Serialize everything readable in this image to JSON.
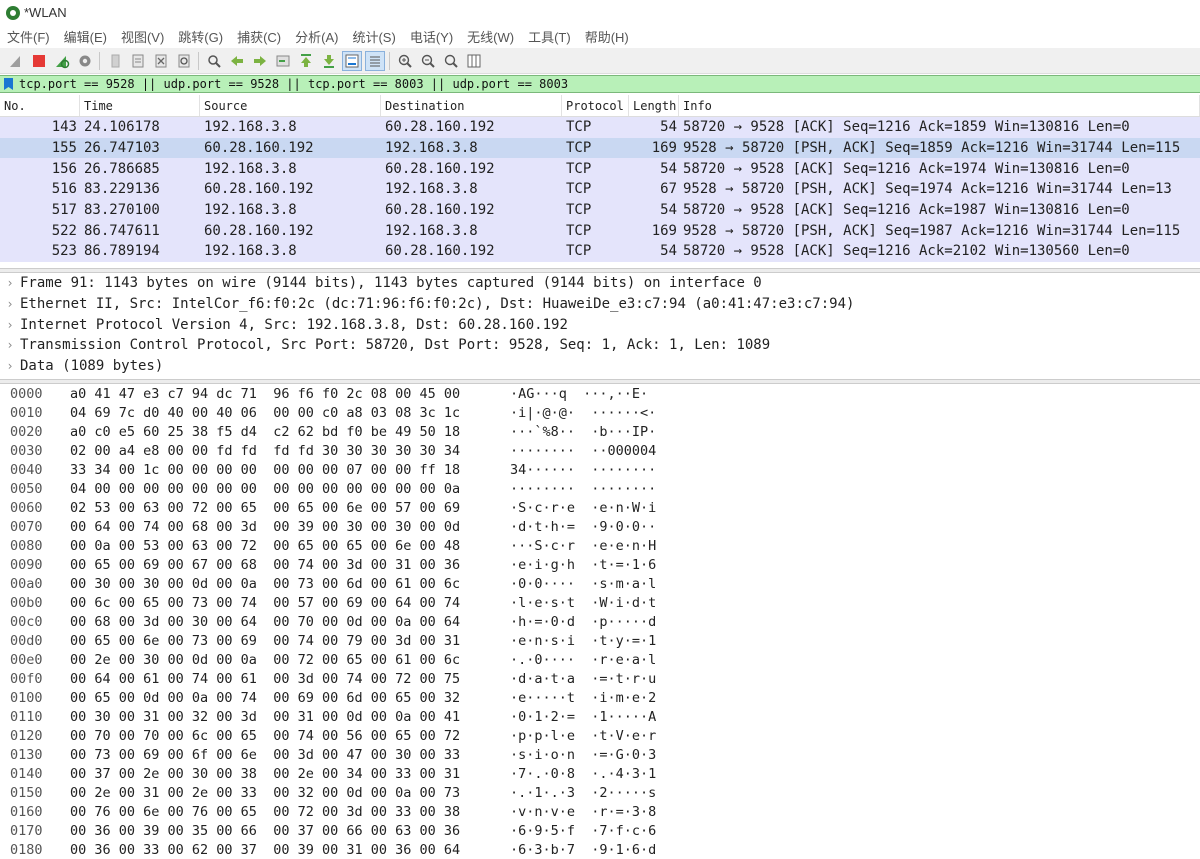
{
  "window": {
    "title": "*WLAN"
  },
  "menu": [
    "文件(F)",
    "编辑(E)",
    "视图(V)",
    "跳转(G)",
    "捕获(C)",
    "分析(A)",
    "统计(S)",
    "电话(Y)",
    "无线(W)",
    "工具(T)",
    "帮助(H)"
  ],
  "toolbar_icons": [
    "shark-fin-icon",
    "stop-icon",
    "restart-icon",
    "options-gear-icon",
    "open-file-icon",
    "save-file-icon",
    "close-file-icon",
    "reload-icon",
    "find-icon",
    "go-back-icon",
    "go-forward-icon",
    "go-to-packet-icon",
    "go-first-icon",
    "go-last-icon",
    "autoscroll-icon",
    "colorize-icon",
    "zoom-in-icon",
    "zoom-out-icon",
    "zoom-normal-icon",
    "resize-columns-icon"
  ],
  "filter": {
    "value": "tcp.port == 9528 || udp.port == 9528 || tcp.port == 8003 || udp.port == 8003"
  },
  "columns": [
    "No.",
    "Time",
    "Source",
    "Destination",
    "Protocol",
    "Length",
    "Info"
  ],
  "packets": [
    {
      "no": "143",
      "time": "24.106178",
      "src": "192.168.3.8",
      "dst": "60.28.160.192",
      "proto": "TCP",
      "len": "54",
      "info": "58720 → 9528 [ACK] Seq=1216 Ack=1859 Win=130816 Len=0"
    },
    {
      "no": "155",
      "time": "26.747103",
      "src": "60.28.160.192",
      "dst": "192.168.3.8",
      "proto": "TCP",
      "len": "169",
      "info": "9528 → 58720 [PSH, ACK] Seq=1859 Ack=1216 Win=31744 Len=115"
    },
    {
      "no": "156",
      "time": "26.786685",
      "src": "192.168.3.8",
      "dst": "60.28.160.192",
      "proto": "TCP",
      "len": "54",
      "info": "58720 → 9528 [ACK] Seq=1216 Ack=1974 Win=130816 Len=0"
    },
    {
      "no": "516",
      "time": "83.229136",
      "src": "60.28.160.192",
      "dst": "192.168.3.8",
      "proto": "TCP",
      "len": "67",
      "info": "9528 → 58720 [PSH, ACK] Seq=1974 Ack=1216 Win=31744 Len=13"
    },
    {
      "no": "517",
      "time": "83.270100",
      "src": "192.168.3.8",
      "dst": "60.28.160.192",
      "proto": "TCP",
      "len": "54",
      "info": "58720 → 9528 [ACK] Seq=1216 Ack=1987 Win=130816 Len=0"
    },
    {
      "no": "522",
      "time": "86.747611",
      "src": "60.28.160.192",
      "dst": "192.168.3.8",
      "proto": "TCP",
      "len": "169",
      "info": "9528 → 58720 [PSH, ACK] Seq=1987 Ack=1216 Win=31744 Len=115"
    },
    {
      "no": "523",
      "time": "86.789194",
      "src": "192.168.3.8",
      "dst": "60.28.160.192",
      "proto": "TCP",
      "len": "54",
      "info": "58720 → 9528 [ACK] Seq=1216 Ack=2102 Win=130560 Len=0"
    }
  ],
  "details": [
    "Frame 91: 1143 bytes on wire (9144 bits), 1143 bytes captured (9144 bits) on interface 0",
    "Ethernet II, Src: IntelCor_f6:f0:2c (dc:71:96:f6:f0:2c), Dst: HuaweiDe_e3:c7:94 (a0:41:47:e3:c7:94)",
    "Internet Protocol Version 4, Src: 192.168.3.8, Dst: 60.28.160.192",
    "Transmission Control Protocol, Src Port: 58720, Dst Port: 9528, Seq: 1, Ack: 1, Len: 1089",
    "Data (1089 bytes)"
  ],
  "hexdump": [
    {
      "off": "0000",
      "hex": "a0 41 47 e3 c7 94 dc 71  96 f6 f0 2c 08 00 45 00",
      "ascii": "·AG···q  ···,··E·"
    },
    {
      "off": "0010",
      "hex": "04 69 7c d0 40 00 40 06  00 00 c0 a8 03 08 3c 1c",
      "ascii": "·i|·@·@·  ······<·"
    },
    {
      "off": "0020",
      "hex": "a0 c0 e5 60 25 38 f5 d4  c2 62 bd f0 be 49 50 18",
      "ascii": "···`%8··  ·b···IP·"
    },
    {
      "off": "0030",
      "hex": "02 00 a4 e8 00 00 fd fd  fd fd 30 30 30 30 30 34",
      "ascii": "········  ··000004"
    },
    {
      "off": "0040",
      "hex": "33 34 00 1c 00 00 00 00  00 00 00 07 00 00 ff 18",
      "ascii": "34······  ········"
    },
    {
      "off": "0050",
      "hex": "04 00 00 00 00 00 00 00  00 00 00 00 00 00 00 0a",
      "ascii": "········  ········"
    },
    {
      "off": "0060",
      "hex": "02 53 00 63 00 72 00 65  00 65 00 6e 00 57 00 69",
      "ascii": "·S·c·r·e  ·e·n·W·i"
    },
    {
      "off": "0070",
      "hex": "00 64 00 74 00 68 00 3d  00 39 00 30 00 30 00 0d",
      "ascii": "·d·t·h·=  ·9·0·0··"
    },
    {
      "off": "0080",
      "hex": "00 0a 00 53 00 63 00 72  00 65 00 65 00 6e 00 48",
      "ascii": "···S·c·r  ·e·e·n·H"
    },
    {
      "off": "0090",
      "hex": "00 65 00 69 00 67 00 68  00 74 00 3d 00 31 00 36",
      "ascii": "·e·i·g·h  ·t·=·1·6"
    },
    {
      "off": "00a0",
      "hex": "00 30 00 30 00 0d 00 0a  00 73 00 6d 00 61 00 6c",
      "ascii": "·0·0····  ·s·m·a·l"
    },
    {
      "off": "00b0",
      "hex": "00 6c 00 65 00 73 00 74  00 57 00 69 00 64 00 74",
      "ascii": "·l·e·s·t  ·W·i·d·t"
    },
    {
      "off": "00c0",
      "hex": "00 68 00 3d 00 30 00 64  00 70 00 0d 00 0a 00 64",
      "ascii": "·h·=·0·d  ·p·····d"
    },
    {
      "off": "00d0",
      "hex": "00 65 00 6e 00 73 00 69  00 74 00 79 00 3d 00 31",
      "ascii": "·e·n·s·i  ·t·y·=·1"
    },
    {
      "off": "00e0",
      "hex": "00 2e 00 30 00 0d 00 0a  00 72 00 65 00 61 00 6c",
      "ascii": "·.·0····  ·r·e·a·l"
    },
    {
      "off": "00f0",
      "hex": "00 64 00 61 00 74 00 61  00 3d 00 74 00 72 00 75",
      "ascii": "·d·a·t·a  ·=·t·r·u"
    },
    {
      "off": "0100",
      "hex": "00 65 00 0d 00 0a 00 74  00 69 00 6d 00 65 00 32",
      "ascii": "·e·····t  ·i·m·e·2"
    },
    {
      "off": "0110",
      "hex": "00 30 00 31 00 32 00 3d  00 31 00 0d 00 0a 00 41",
      "ascii": "·0·1·2·=  ·1·····A"
    },
    {
      "off": "0120",
      "hex": "00 70 00 70 00 6c 00 65  00 74 00 56 00 65 00 72",
      "ascii": "·p·p·l·e  ·t·V·e·r"
    },
    {
      "off": "0130",
      "hex": "00 73 00 69 00 6f 00 6e  00 3d 00 47 00 30 00 33",
      "ascii": "·s·i·o·n  ·=·G·0·3"
    },
    {
      "off": "0140",
      "hex": "00 37 00 2e 00 30 00 38  00 2e 00 34 00 33 00 31",
      "ascii": "·7·.·0·8  ·.·4·3·1"
    },
    {
      "off": "0150",
      "hex": "00 2e 00 31 00 2e 00 33  00 32 00 0d 00 0a 00 73",
      "ascii": "·.·1·.·3  ·2·····s"
    },
    {
      "off": "0160",
      "hex": "00 76 00 6e 00 76 00 65  00 72 00 3d 00 33 00 38",
      "ascii": "·v·n·v·e  ·r·=·3·8"
    },
    {
      "off": "0170",
      "hex": "00 36 00 39 00 35 00 66  00 37 00 66 00 63 00 36",
      "ascii": "·6·9·5·f  ·7·f·c·6"
    },
    {
      "off": "0180",
      "hex": "00 36 00 33 00 62 00 37  00 39 00 31 00 36 00 64",
      "ascii": "·6·3·b·7  ·9·1·6·d"
    }
  ]
}
